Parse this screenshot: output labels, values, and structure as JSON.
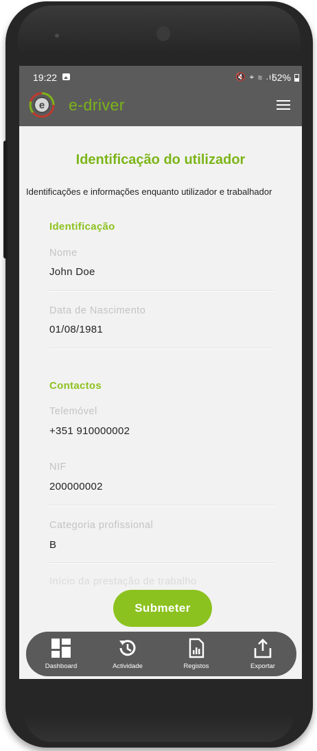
{
  "status_bar": {
    "time": "19:22",
    "icons": "🔇 ⌖ ≋ .ıl",
    "battery": "52%"
  },
  "app_bar": {
    "brand": "e-driver",
    "colors": {
      "bar": "#5b5b5b",
      "accent": "#7cb518"
    }
  },
  "page": {
    "title": "Identificação do utilizador",
    "subtitle": "Identificações e informações enquanto utilizador e trabalhador"
  },
  "sections": {
    "identificacao": "Identificação",
    "contactos": "Contactos"
  },
  "fields": {
    "nome": {
      "label": "Nome",
      "value": "John Doe"
    },
    "data_nascimento": {
      "label": "Data de Nascimento",
      "value": "01/08/1981"
    },
    "telemovel": {
      "label": "Telemóvel",
      "value": "+351 910000002"
    },
    "nif": {
      "label": "NIF",
      "value": "200000002"
    },
    "categoria": {
      "label": "Categoria profissional",
      "value": "B"
    },
    "inicio": {
      "label": "Início da prestação de trabalho"
    }
  },
  "submit_label": "Submeter",
  "bottom_nav": [
    {
      "label": "Dashboard",
      "icon": "dashboard-icon"
    },
    {
      "label": "Actividade",
      "icon": "history-icon"
    },
    {
      "label": "Registos",
      "icon": "report-icon"
    },
    {
      "label": "Exportar",
      "icon": "share-icon"
    }
  ]
}
